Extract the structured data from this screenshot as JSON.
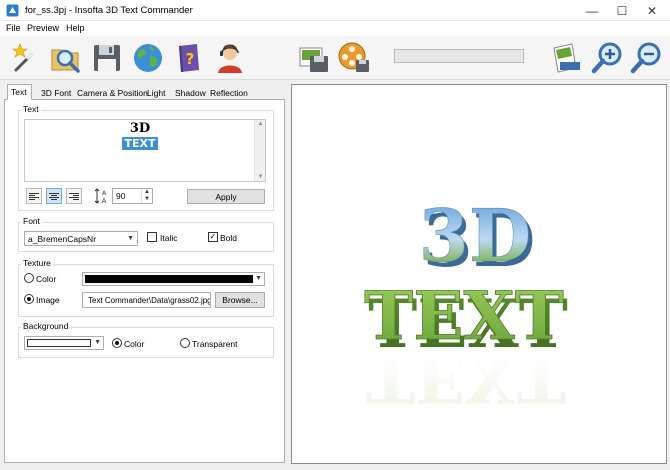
{
  "window": {
    "title": "for_ss.3pj - Insofta 3D Text Commander",
    "min_glyph": "—",
    "max_glyph": "☐",
    "close_glyph": "✕"
  },
  "menu": [
    "File",
    "Preview",
    "Help"
  ],
  "toolbar": {
    "icons": [
      "magic-wand-icon",
      "open-folder-magnifier-icon",
      "floppy-save-icon",
      "globe-icon",
      "help-book-icon",
      "support-agent-icon",
      "save-image-icon",
      "film-reel-icon",
      "export-card-icon",
      "zoom-in-icon",
      "zoom-out-icon"
    ],
    "progress": 0
  },
  "tabs": [
    "Text",
    "3D Font",
    "Camera & Position",
    "Light",
    "Shadow",
    "Reflection"
  ],
  "active_tab": "Text",
  "text_group": {
    "label": "Text",
    "content_line1": "3D",
    "content_line2": "TEXT",
    "alignment": "center",
    "size_value": "90",
    "apply_label": "Apply"
  },
  "font_group": {
    "label": "Font",
    "font_name": "a_BremenCapsNr",
    "italic_label": "Italic",
    "italic": false,
    "bold_label": "Bold",
    "bold": true
  },
  "texture_group": {
    "label": "Texture",
    "color_label": "Color",
    "color_value": "#000000",
    "image_label": "Image",
    "image_path": "Text Commander\\Data\\grass02.jpg",
    "browse_label": "Browse...",
    "selected": "image"
  },
  "background_group": {
    "label": "Background",
    "color_value": "#ffffff",
    "color_label": "Color",
    "transparent_label": "Transparent",
    "selected": "color"
  },
  "preview": {
    "line1": "3D",
    "line2": "TEXT"
  },
  "colors": {
    "accent": "#0078d7",
    "grass": "#6aa33a",
    "sky": "#7fb4e0"
  }
}
